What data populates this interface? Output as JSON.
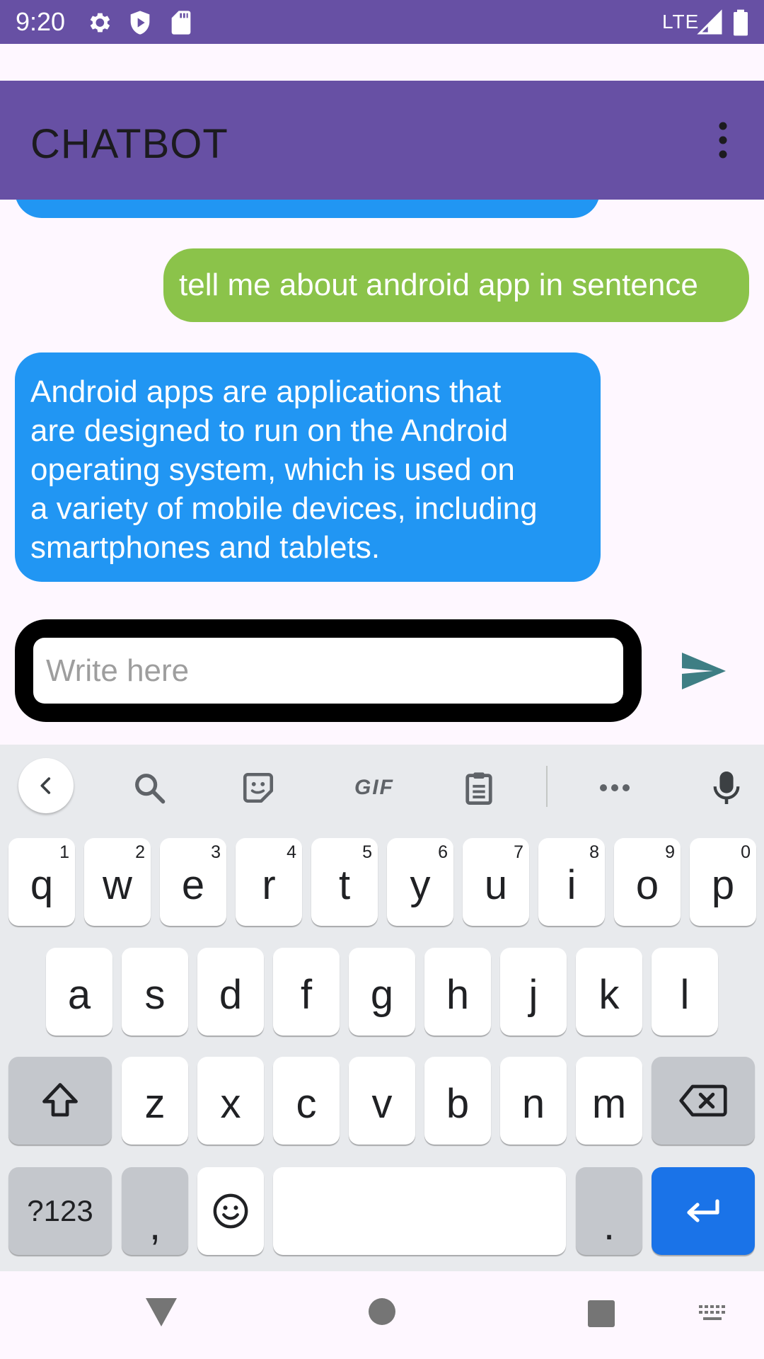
{
  "status_bar": {
    "time": "9:20",
    "network": "LTE",
    "icons": [
      "settings-icon",
      "shield-icon",
      "sd-card-icon",
      "signal-icon",
      "battery-icon"
    ]
  },
  "app_bar": {
    "title": "CHATBOT",
    "menu_icon": "more-vert-icon"
  },
  "chat": {
    "messages": [
      {
        "sender": "user",
        "text": "tell me about android app in sentence"
      },
      {
        "sender": "bot",
        "lines": [
          "Android apps are applications that",
          "are designed to run on the Android",
          "operating system, which is used on",
          "a variety of mobile devices, including",
          "smartphones and tablets."
        ]
      }
    ]
  },
  "composer": {
    "placeholder": "Write here",
    "value": "",
    "send_icon": "send-icon"
  },
  "keyboard": {
    "toolbar": [
      "back-icon",
      "search-icon",
      "sticker-icon",
      "GIF",
      "clipboard-icon",
      "more-horiz-icon",
      "mic-icon"
    ],
    "row1": [
      {
        "k": "q",
        "h": "1"
      },
      {
        "k": "w",
        "h": "2"
      },
      {
        "k": "e",
        "h": "3"
      },
      {
        "k": "r",
        "h": "4"
      },
      {
        "k": "t",
        "h": "5"
      },
      {
        "k": "y",
        "h": "6"
      },
      {
        "k": "u",
        "h": "7"
      },
      {
        "k": "i",
        "h": "8"
      },
      {
        "k": "o",
        "h": "9"
      },
      {
        "k": "p",
        "h": "0"
      }
    ],
    "row2": [
      "a",
      "s",
      "d",
      "f",
      "g",
      "h",
      "j",
      "k",
      "l"
    ],
    "row3": [
      "z",
      "x",
      "c",
      "v",
      "b",
      "n",
      "m"
    ],
    "symbols_label": "?123",
    "comma": ",",
    "period": "."
  },
  "nav_bar": {
    "icons": [
      "back-triangle-icon",
      "home-circle-icon",
      "recents-square-icon",
      "keyboard-switch-icon"
    ]
  },
  "colors": {
    "primary": "#6750A4",
    "user_bubble": "#8BC34A",
    "bot_bubble": "#2196F3",
    "enter_key": "#1A73E8",
    "send_icon": "#3E7E84"
  }
}
